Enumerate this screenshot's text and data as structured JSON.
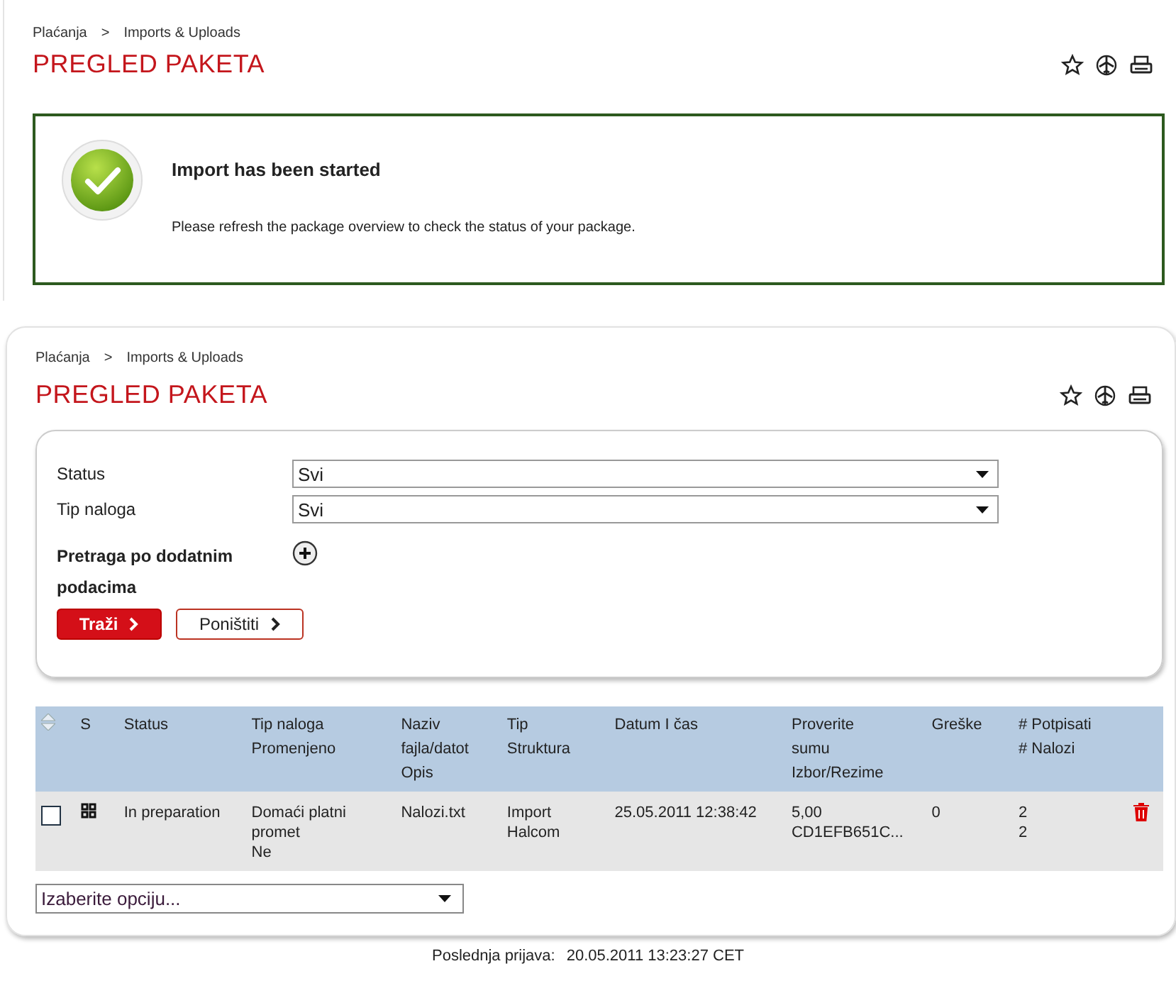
{
  "top_panel": {
    "breadcrumbs": [
      "Plaćanja",
      "Imports & Uploads"
    ],
    "breadcrumb_separator": ">",
    "title": "PREGLED PAKETA",
    "message": {
      "title": "Import has been started",
      "text": "Please refresh the package overview to check the status of your package."
    }
  },
  "main_panel": {
    "breadcrumbs": [
      "Plaćanja",
      "Imports & Uploads"
    ],
    "breadcrumb_separator": ">",
    "title": "PREGLED PAKETA",
    "filters": [
      {
        "label": "Status",
        "value": "Svi"
      },
      {
        "label": "Tip naloga",
        "value": "Svi"
      }
    ],
    "extra_search": {
      "label": "Pretraga po dodatnim podacima",
      "expanded": false
    },
    "buttons": [
      {
        "label": "Traži",
        "kind": "primary"
      },
      {
        "label": "Poništiti",
        "kind": "secondary"
      }
    ],
    "table": {
      "columns": [
        "S",
        "Status",
        "Tip naloga\nPromenjeno",
        "Naziv\nfajla/datot\nOpis",
        "Tip\nStruktura",
        "Datum I čas",
        "Proverite\nsumu\nIzbor/Rezime",
        "Greške",
        "# Potpisati\n# Nalozi"
      ],
      "rows": [
        {
          "checked": false,
          "cells": [
            "",
            "In preparation",
            "Domaći platni\npromet\nNe",
            "Nalozi.txt",
            "Import\nHalcom",
            "25.05.2011 12:38:42",
            "5,00\nCD1EFB651C...",
            "0",
            "2\n2"
          ]
        }
      ]
    },
    "action_select": {
      "placeholder": "Izaberite opciju..."
    }
  },
  "footer": {
    "label": "Poslednja prijava:",
    "value": "20.05.2011 13:23:27 CET"
  }
}
